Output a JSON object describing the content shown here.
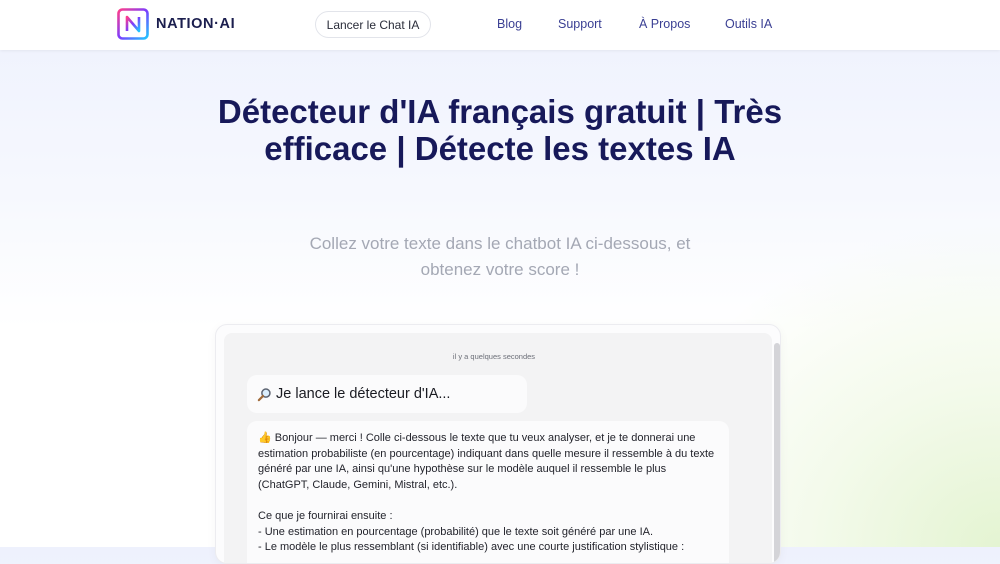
{
  "header": {
    "logo_text": "NATION·AI",
    "logo_letter": "N",
    "chat_button_label": "Lancer le Chat IA",
    "nav": [
      "Blog",
      "Support",
      "À Propos",
      "Outils IA"
    ]
  },
  "hero": {
    "title": "Détecteur d'IA français gratuit | Très efficace | Détecte les textes IA",
    "subtitle": "Collez votre texte dans le chatbot IA ci-dessous, et obtenez votre score !"
  },
  "chat": {
    "timestamp": "il y a quelques secondes",
    "message_1": {
      "icon": "magnifier-icon",
      "text": "Je lance le détecteur d'IA..."
    },
    "message_2": {
      "intro": "👍 Bonjour — merci ! Colle ci-dessous le texte que tu veux analyser, et je te donnerai une estimation probabiliste (en pourcentage) indiquant dans quelle mesure il ressemble à du texte généré par une IA, ainsi qu'une hypothèse sur le modèle auquel il ressemble le plus (ChatGPT, Claude, Gemini, Mistral, etc.).",
      "list_title": "Ce que je fournirai ensuite :",
      "items": [
        "- Une estimation en pourcentage (probabilité) que le texte soit généré par une IA.",
        "- Le modèle le plus ressemblant (si identifiable) avec une courte justification stylistique :"
      ]
    }
  },
  "colors": {
    "title": "#17195a",
    "nav": "#3a3f93",
    "subtitle": "#a4a8b4",
    "logo_gradient": [
      "#ff3d8a",
      "#7b3dff",
      "#1ec8ff"
    ]
  }
}
